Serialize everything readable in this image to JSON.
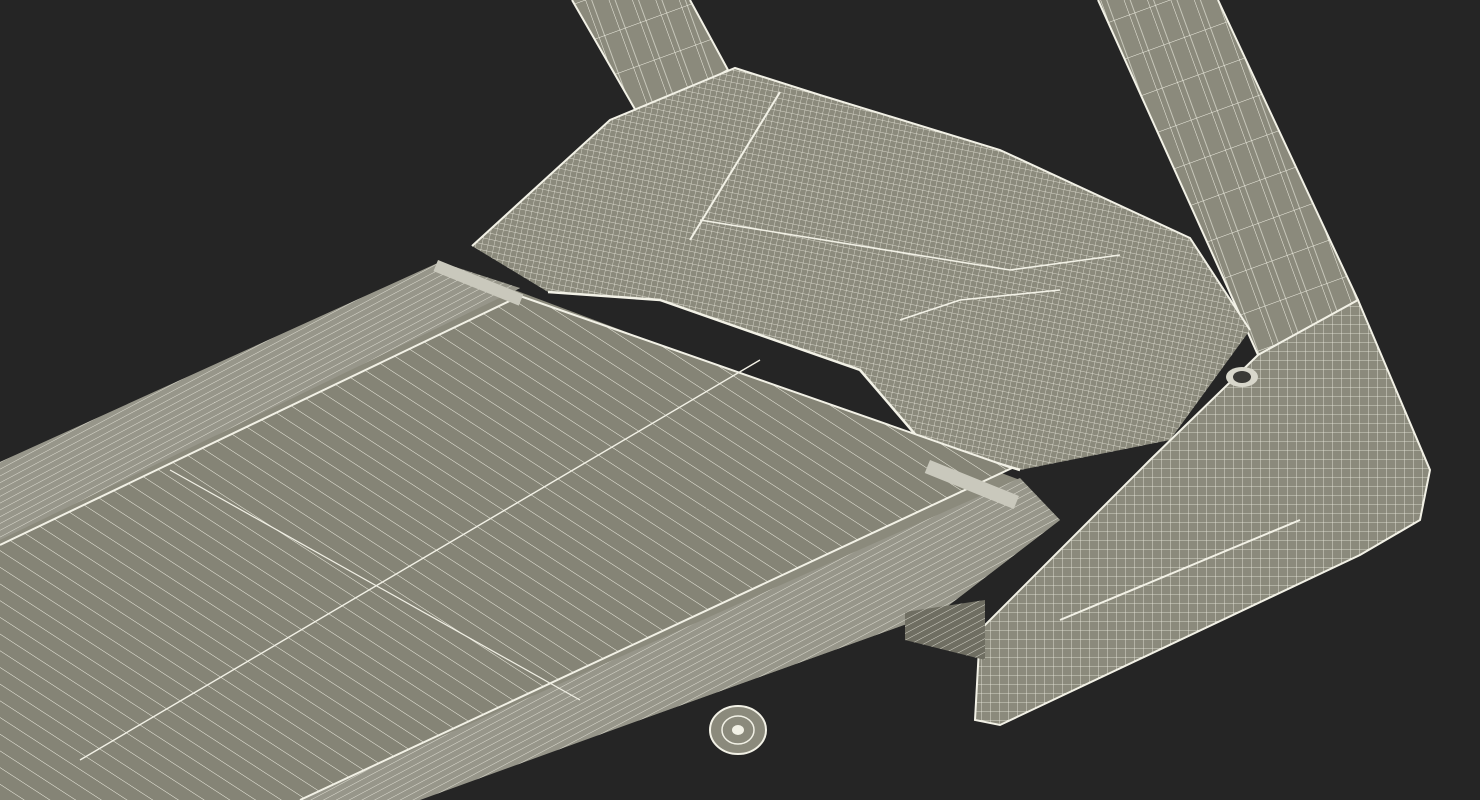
{
  "scene": {
    "subject": "treadmill-wireframe-render",
    "colors": {
      "background": "#252525",
      "surface": "#8b8a7c",
      "surface_dark": "#6f6e62",
      "surface_light": "#a09f90",
      "wire": "#f2f1e6",
      "wire_dense": "#e9e8dc"
    }
  }
}
